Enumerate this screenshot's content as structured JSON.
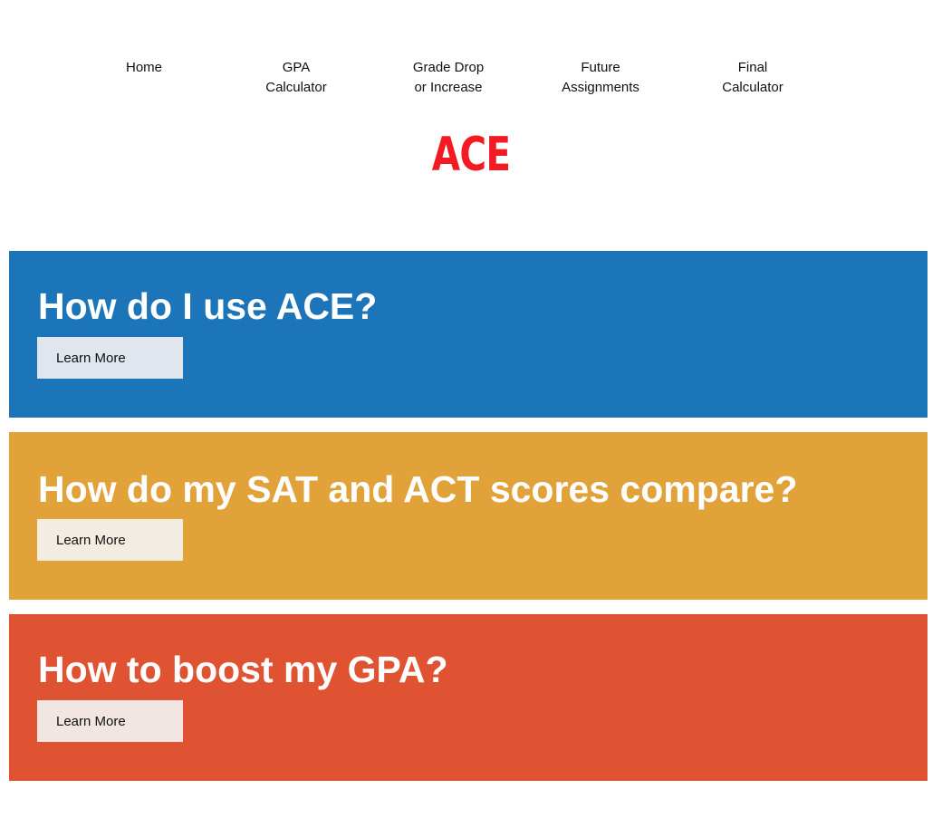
{
  "nav": {
    "items": [
      {
        "label": "Home"
      },
      {
        "label": "GPA\nCalculator"
      },
      {
        "label": "Grade Drop\nor Increase"
      },
      {
        "label": "Future\nAssignments"
      },
      {
        "label": "Final\nCalculator"
      }
    ]
  },
  "logo": {
    "text": "ACE",
    "color": "#f21b24"
  },
  "cards": [
    {
      "title": "How do I use ACE?",
      "button_label": "Learn More",
      "color": "#1b75b8",
      "button_color": "#dfe6ed"
    },
    {
      "title": "How do my SAT and ACT scores compare?",
      "button_label": "Learn More",
      "color": "#e2a23a",
      "button_color": "#f2ece3"
    },
    {
      "title": "How to boost my GPA?",
      "button_label": "Learn More",
      "color": "#e05332",
      "button_color": "#f2e6e3"
    }
  ]
}
